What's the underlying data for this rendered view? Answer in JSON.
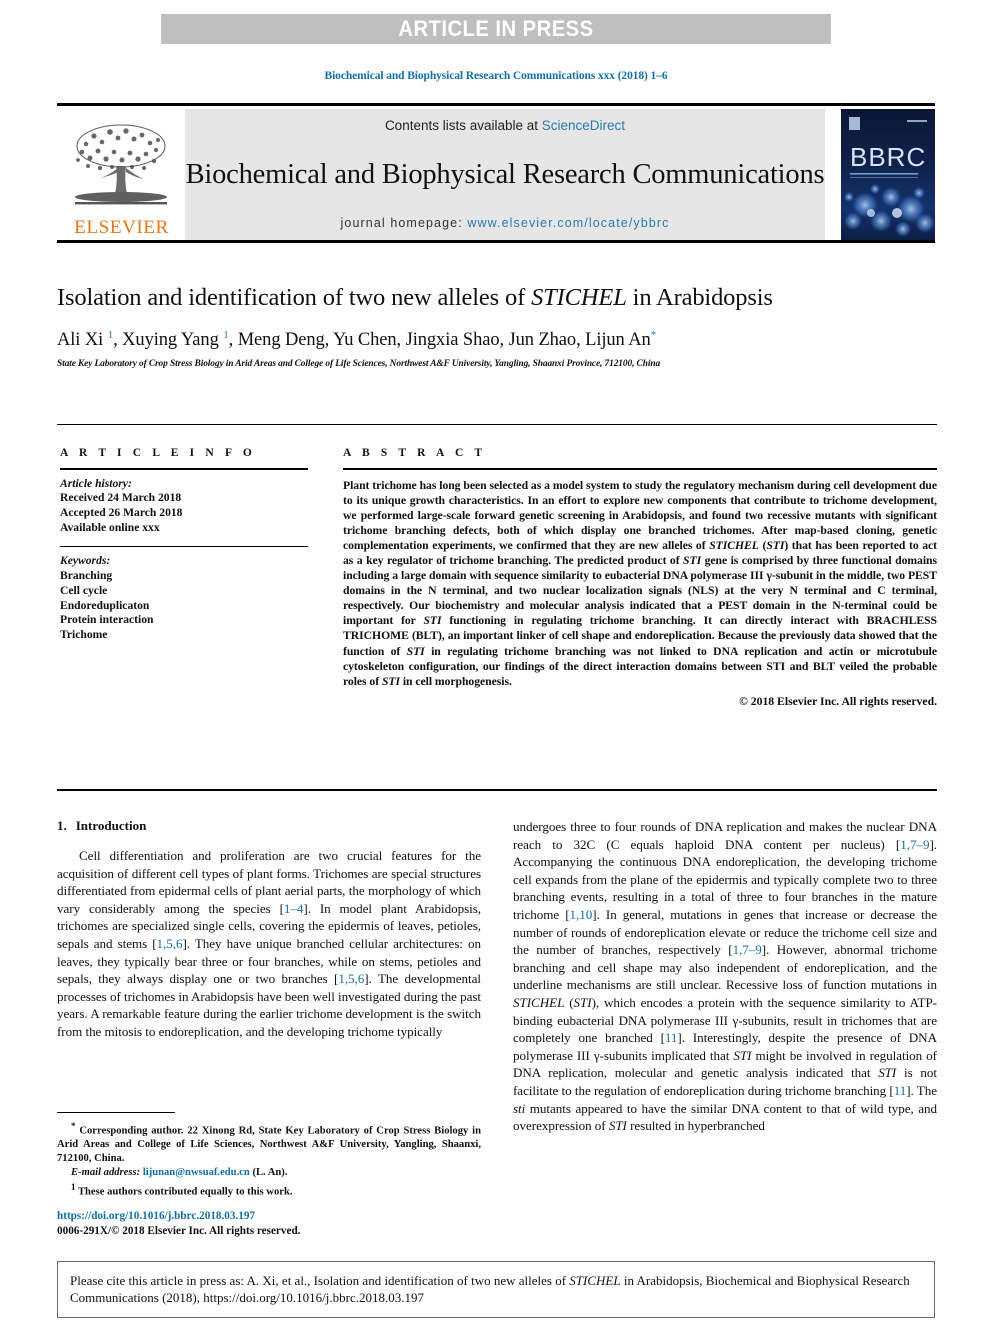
{
  "banner": {
    "label": "ARTICLE IN PRESS"
  },
  "running_head": "Biochemical and Biophysical Research Communications xxx (2018) 1–6",
  "masthead": {
    "publisher_logo_label": "ELSEVIER",
    "contents_prefix": "Contents lists available at ",
    "contents_link": "ScienceDirect",
    "journal_title": "Biochemical and Biophysical Research Communications",
    "homepage_prefix": "journal homepage: ",
    "homepage_link": "www.elsevier.com/locate/ybbrc",
    "cover_title": "BBRC"
  },
  "article": {
    "title_part1": "Isolation and identification of two new alleles of ",
    "title_italic": "STICHEL",
    "title_part2": " in Arabidopsis",
    "authors_html": "Ali Xi <sup>1</sup>, Xuying Yang <sup>1</sup>, Meng Deng, Yu Chen, Jingxia Shao, Jun Zhao, Lijun An<sup>*</sup>",
    "affiliation": "State Key Laboratory of Crop Stress Biology in Arid Areas and College of Life Sciences, Northwest A&F University, Yangling, Shaanxi Province, 712100, China"
  },
  "article_info": {
    "heading": "A R T I C L E   I N F O",
    "history_title": "Article history:",
    "history": [
      "Received 24 March 2018",
      "Accepted 26 March 2018",
      "Available online xxx"
    ],
    "keywords_title": "Keywords:",
    "keywords": [
      "Branching",
      "Cell cycle",
      "Endoreduplicaton",
      "Protein interaction",
      "Trichome"
    ]
  },
  "abstract": {
    "heading": "A B S T R A C T",
    "body_html": "Plant trichome has long been selected as a model system to study the regulatory mechanism during cell development due to its unique growth characteristics. In an effort to explore new components that contribute to trichome development, we performed large-scale forward genetic screening in Arabidopsis, and found two recessive mutants with significant trichome branching defects, both of which display one branched trichomes. After map-based cloning, genetic complementation experiments, we confirmed that they are new alleles of <i>STICHEL</i> (<i>STI</i>) that has been reported to act as a key regulator of trichome branching. The predicted product of <i>STI</i> gene is comprised by three functional domains including a large domain with sequence similarity to eubacterial DNA polymerase III γ-subunit in the middle, two PEST domains in the N terminal, and two nuclear localization signals (NLS) at the very N terminal and C terminal, respectively. Our biochemistry and molecular analysis indicated that a PEST domain in the N-terminal could be important for <i>STI</i> functioning in regulating trichome branching. It can directly interact with BRACHLESS TRICHOME (BLT), an important linker of cell shape and endoreplication. Because the previously data showed that the function of <i>STI</i> in regulating trichome branching was not linked to DNA replication and actin or microtubule cytoskeleton configuration, our findings of the direct interaction domains between STI and BLT veiled the probable roles of <i>STI</i> in cell morphogenesis.",
    "copyright": "© 2018 Elsevier Inc. All rights reserved."
  },
  "introduction": {
    "section_number": "1.",
    "section_title": "Introduction",
    "left_column_html": "Cell differentiation and proliferation are two crucial features for the acquisition of different cell types of plant forms. Trichomes are special structures differentiated from epidermal cells of plant aerial parts, the morphology of which vary considerably among the species [<span class=\"ref\">1–4</span>]. In model plant Arabidopsis, trichomes are specialized single cells, covering the epidermis of leaves, petioles, sepals and stems [<span class=\"ref\">1,5,6</span>]. They have unique branched cellular architectures: on leaves, they typically bear three or four branches, while on stems, petioles and sepals, they always display one or two branches [<span class=\"ref\">1,5,6</span>]. The developmental processes of trichomes in Arabidopsis have been well investigated during the past years. A remarkable feature during the earlier trichome development is the switch from the mitosis to endoreplication, and the developing trichome typically",
    "right_column_html": "undergoes three to four rounds of DNA replication and makes the nuclear DNA reach to 32C (C equals haploid DNA content per nucleus) [<span class=\"ref\">1,7–9</span>]. Accompanying the continuous DNA endoreplication, the developing trichome cell expands from the plane of the epidermis and typically complete two to three branching events, resulting in a total of three to four branches in the mature trichome [<span class=\"ref\">1,10</span>]. In general, mutations in genes that increase or decrease the number of rounds of endoreplication elevate or reduce the trichome cell size and the number of branches, respectively [<span class=\"ref\">1,7–9</span>]. However, abnormal trichome branching and cell shape may also independent of endoreplication, and the underline mechanisms are still unclear. Recessive loss of function mutations in <i>STICHEL</i> (<i>STI</i>), which encodes a protein with the sequence similarity to ATP-binding eubacterial DNA polymerase III γ-subunits, result in trichomes that are completely one branched [<span class=\"ref\">11</span>]. Interestingly, despite the presence of DNA polymerase III γ-subunits implicated that <i>STI</i> might be involved in regulation of DNA replication, molecular and genetic analysis indicated that <i>STI</i> is not facilitate to the regulation of endoreplication during trichome branching [<span class=\"ref\">11</span>]. The <i>sti</i> mutants appeared to have the similar DNA content to that of wild type, and overexpression of <i>STI</i> resulted in hyperbranched"
  },
  "footnotes": {
    "corresponding_html": "<span class=\"fn-mark\">*</span> Corresponding author. 22 Xinong Rd, State Key Laboratory of Crop Stress Biology in Arid Areas and College of Life Sciences, Northwest A&amp;F University, Yangling, Shaanxi, 712100, China.",
    "email_label": "E-mail address:",
    "email_address": "lijunan@nwsuaf.edu.cn",
    "email_suffix": " (L. An).",
    "equal_contrib_html": "<span class=\"fn-mark\">1</span> These authors contributed equally to this work.",
    "doi_url": "https://doi.org/10.1016/j.bbrc.2018.03.197",
    "issn_line": "0006-291X/© 2018 Elsevier Inc. All rights reserved."
  },
  "citation_footer": {
    "text_part1": "Please cite this article in press as: A. Xi, et al., Isolation and identification of two new alleles of ",
    "text_italic": "STICHEL",
    "text_part2": " in Arabidopsis, Biochemical and Biophysical Research Communications (2018), https://doi.org/10.1016/j.bbrc.2018.03.197"
  },
  "colors": {
    "link_blue": "#1270a8",
    "sciencedirect_blue": "#2a7ab0",
    "elsevier_orange": "#e8761a",
    "banner_gray": "#bfbfbf",
    "journal_box_gray": "#e6e6e6"
  }
}
